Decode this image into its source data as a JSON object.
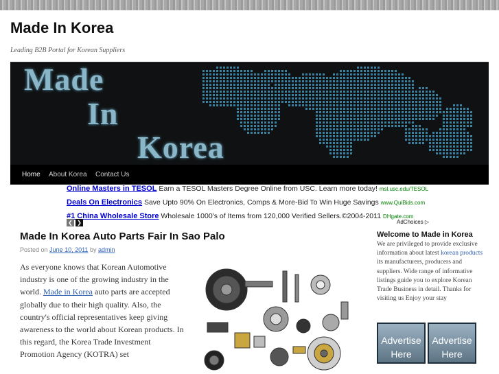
{
  "site": {
    "title": "Made In Korea",
    "tagline": "Leading B2B Portal for Korean Suppliers"
  },
  "banner": {
    "words": [
      "Made",
      "In",
      "Korea"
    ]
  },
  "nav": {
    "items": [
      {
        "label": "Home",
        "active": true
      },
      {
        "label": "About Korea",
        "active": false
      },
      {
        "label": "Contact Us",
        "active": false
      }
    ]
  },
  "ads": {
    "rows": [
      {
        "title": "Online Masters in TESOL",
        "desc": "Earn a TESOL Masters Degree Online from USC. Learn more today!",
        "url": "msl.usc.edu/TESOL"
      },
      {
        "title": "Deals On Electronics",
        "desc": "Save Upto 90% On Electronics, Comps & More-Bid To Win Huge Savings",
        "url": "www.QuiBids.com"
      },
      {
        "title": "#1 China Wholesale Store",
        "desc": "Wholesale 1000's of Items from 120,000 Verified Sellers.©2004-2011",
        "url": "DHgate.com"
      }
    ],
    "prev_glyph": "❮",
    "next_glyph": "❯",
    "adchoices": "AdChoices ▷"
  },
  "post": {
    "title": "Made In Korea Auto Parts Fair In Sao Palo",
    "meta_prefix": "Posted on",
    "date": "June 10, 2011",
    "meta_by": "by",
    "author": "admin",
    "body_before": "As everyone knows that Korean Automotive industry is one of the growing industry in the world.",
    "body_link": "Made in Korea",
    "body_after": "auto parts are accepted globally due to their high quality. Also, the country's official representatives keep giving awareness to the world about Korean products. In this regard, the Korea Trade Investment Promotion Agency (KOTRA) set"
  },
  "sidebar": {
    "widget_title": "Welcome to Made in Korea",
    "text_before": "We are privileged to provide exclusive information about latest",
    "text_link": "korean products",
    "text_after": "its manufacturers, producers and suppliers. Wide range of informative listings guide you to explore Korean Trade Business in detail. Thanks for visiting us Enjoy your stay",
    "ad1_line1": "Advertise",
    "ad1_line2": "Here",
    "ad2_line1": "Advertise",
    "ad2_line2": "Here"
  }
}
